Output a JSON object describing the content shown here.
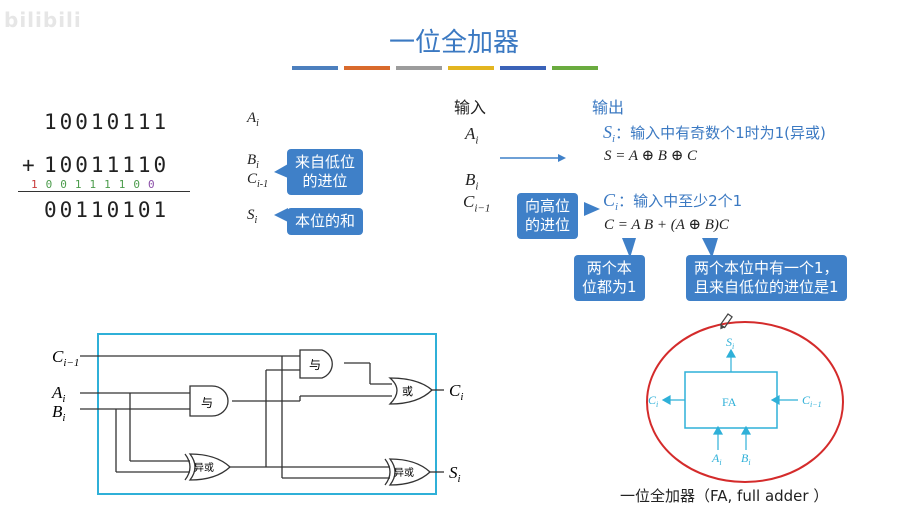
{
  "watermark": "bilibili",
  "title": "一位全加器",
  "title_bar_colors": [
    "#4c7fbe",
    "#d96a2c",
    "#9c9c9c",
    "#e3b520",
    "#3a62b8",
    "#6aab3f"
  ],
  "binary_example": {
    "addend_a": "10010111",
    "addend_b_prefix": "+",
    "addend_b": "10011110",
    "carries": [
      "1",
      "0",
      "0",
      "1",
      "1",
      "1",
      "1",
      "0",
      "0"
    ],
    "carry_colors": [
      "#c83a3a",
      "#4c9c4c",
      "#4c9c4c",
      "#4c9c4c",
      "#4c9c4c",
      "#4c9c4c",
      "#4c9c4c",
      "#4c9c4c",
      "#8b4fa8"
    ],
    "sum": "00110101"
  },
  "labels": {
    "a": "A",
    "a_sub": "i",
    "b": "B",
    "b_sub": "i",
    "c": "C",
    "c_sub": "i-1",
    "s": "S",
    "s_sub": "i"
  },
  "callouts": {
    "carry_in": [
      "来自低位",
      "的进位"
    ],
    "sum_bit": "本位的和",
    "carry_out": [
      "向高位",
      "的进位"
    ],
    "both_ones": [
      "两个本",
      "位都为1"
    ],
    "one_and_carry": [
      "两个本位中有一个1，",
      "且来自低位的进位是1"
    ]
  },
  "io": {
    "input_header": "输入",
    "output_header": "输出",
    "s_label": "S",
    "s_sub": "i",
    "s_desc": "：输入中有奇数个1时为1(异或)",
    "s_formula": "S = A ⊕ B ⊕ C",
    "c_label": "C",
    "c_sub": "i",
    "c_desc": "：输入中至少2个1",
    "c_formula": "C = A B + (A ⊕ B)C"
  },
  "circuit": {
    "in_c": "C",
    "in_c_sub": "i−1",
    "in_a": "A",
    "in_a_sub": "i",
    "in_b": "B",
    "in_b_sub": "i",
    "gate_and": "与",
    "gate_or": "或",
    "gate_xor": "异或",
    "out_c": "C",
    "out_c_sub": "i",
    "out_s": "S",
    "out_s_sub": "i"
  },
  "fa_block": {
    "label": "FA",
    "top": "S",
    "top_sub": "i",
    "left": "C",
    "left_sub": "i",
    "right": "C",
    "right_sub": "i−1",
    "bottom_a": "A",
    "bottom_a_sub": "i",
    "bottom_b": "B",
    "bottom_b_sub": "i",
    "caption": "一位全加器（FA, full adder ）"
  }
}
